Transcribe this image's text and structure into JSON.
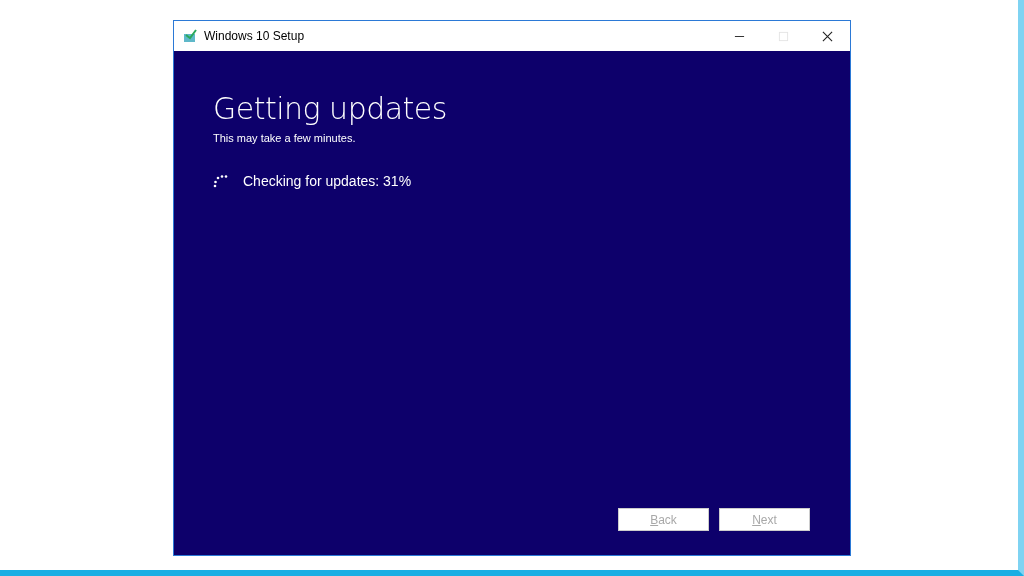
{
  "window": {
    "title": "Windows 10 Setup"
  },
  "page": {
    "heading": "Getting updates",
    "subtitle": "This may take a few minutes.",
    "status": "Checking for updates: 31%"
  },
  "buttons": [
    {
      "label": "Back",
      "disabled": true
    },
    {
      "label": "Next",
      "disabled": true
    }
  ]
}
